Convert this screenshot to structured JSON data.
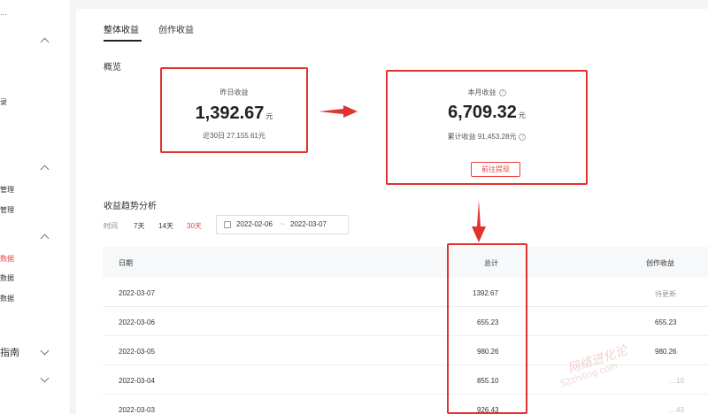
{
  "sidebar": {
    "items": [
      {
        "label": "…"
      },
      {
        "label": "录"
      },
      {
        "label": "管理"
      },
      {
        "label": "管理"
      },
      {
        "label": "数据"
      },
      {
        "label": "数据"
      },
      {
        "label": "数据"
      },
      {
        "label": "指南"
      }
    ]
  },
  "tabs": [
    "整体收益",
    "创作收益"
  ],
  "overview": {
    "title": "概览",
    "yesterday": {
      "label": "昨日收益",
      "value": "1,392.67",
      "unit": "元",
      "sub": "近30日 27,155.61元"
    },
    "month": {
      "label": "本月收益",
      "value": "6,709.32",
      "unit": "元",
      "sub": "累计收益 91,453.28元",
      "button": "前往提现"
    }
  },
  "trend": {
    "title": "收益趋势分析",
    "time_label": "时间",
    "ranges": [
      "7天",
      "14天",
      "30天"
    ],
    "active_range": "30天",
    "date_start": "2022-02-06",
    "date_sep": "~",
    "date_end": "2022-03-07"
  },
  "table": {
    "columns": [
      "日期",
      "总计",
      "创作收益"
    ],
    "rows": [
      {
        "date": "2022-03-07",
        "total": "1392.67",
        "creative": "待更新"
      },
      {
        "date": "2022-03-06",
        "total": "655.23",
        "creative": "655.23"
      },
      {
        "date": "2022-03-05",
        "total": "980.26",
        "creative": "980.26"
      },
      {
        "date": "2022-03-04",
        "total": "855.10",
        "creative": "…10"
      },
      {
        "date": "2022-03-03",
        "total": "926.43",
        "creative": "…43"
      }
    ]
  },
  "watermark": {
    "text": "网络进化论",
    "sub": "52zhiling.com"
  },
  "colors": {
    "accent": "#f04142",
    "annotation": "#e0322f"
  }
}
